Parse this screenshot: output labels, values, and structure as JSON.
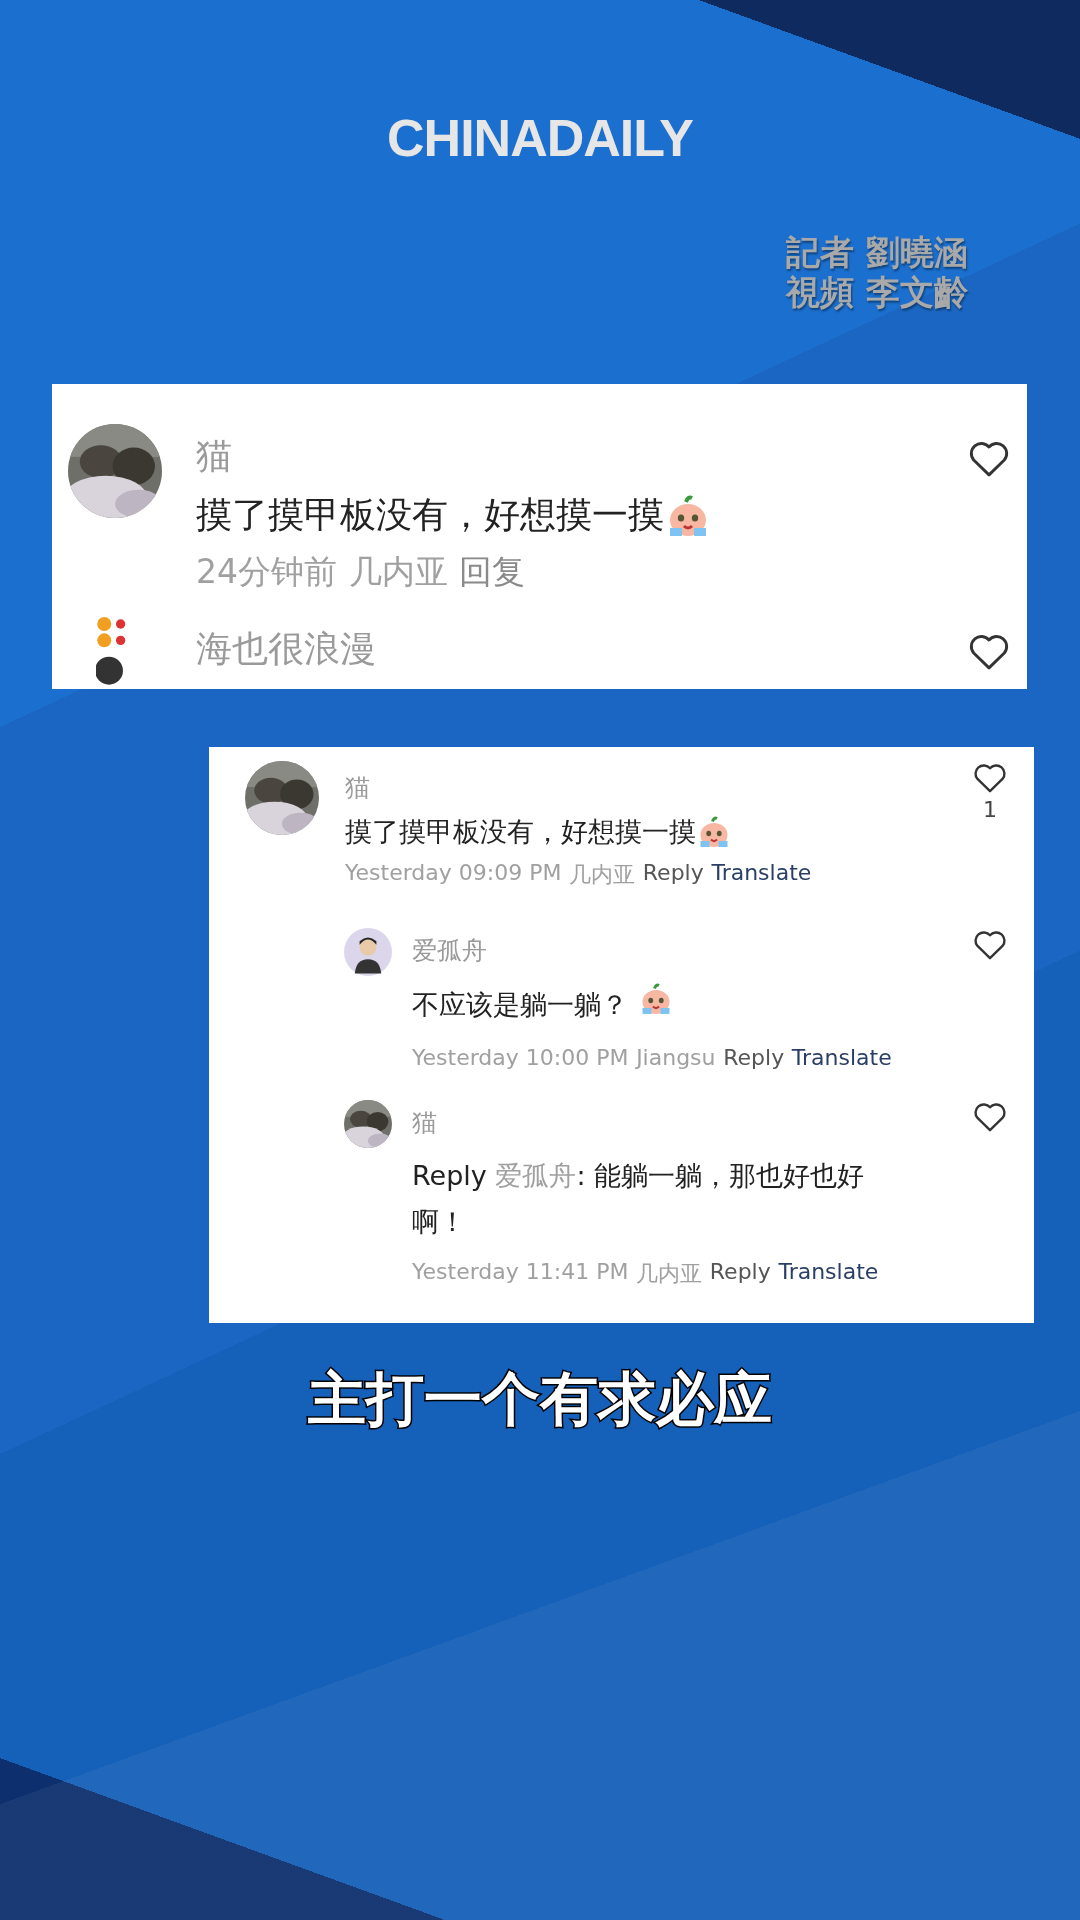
{
  "logo": "CHINADAILY",
  "credits": [
    "記者 劉曉涵",
    "視頻 李文齡"
  ],
  "top_card": {
    "comments": [
      {
        "kind": "picture",
        "name": "猫",
        "text": "摸了摸甲板没有，好想摸一摸",
        "has_emoji": true,
        "meta": [
          "24分钟前",
          "几内亚"
        ],
        "reply": "回复"
      },
      {
        "kind": "dots",
        "name": "海也很浪漫"
      }
    ]
  },
  "bottom_card": {
    "comment": {
      "kind": "picture",
      "name": "猫",
      "text": "摸了摸甲板没有，好想摸一摸",
      "has_emoji": true,
      "likes": "1",
      "time": "Yesterday 09:09 PM",
      "location": "几内亚",
      "reply": "Reply",
      "translate": "Translate"
    },
    "replies": [
      {
        "kind": "figure",
        "name": "爱孤舟",
        "text": "不应该是躺一躺？",
        "has_emoji": true,
        "time": "Yesterday 10:00 PM",
        "location": "Jiangsu",
        "reply": "Reply",
        "translate": "Translate"
      },
      {
        "kind": "picture",
        "name": "猫",
        "reply_prefix": "Reply",
        "reply_to": "爱孤舟",
        "text": ": 能躺一躺，那也好也好啊！",
        "has_emoji": false,
        "time": "Yesterday 11:41 PM",
        "location": "几内亚",
        "reply": "Reply",
        "translate": "Translate"
      }
    ]
  },
  "caption": "主打一个有求必应"
}
